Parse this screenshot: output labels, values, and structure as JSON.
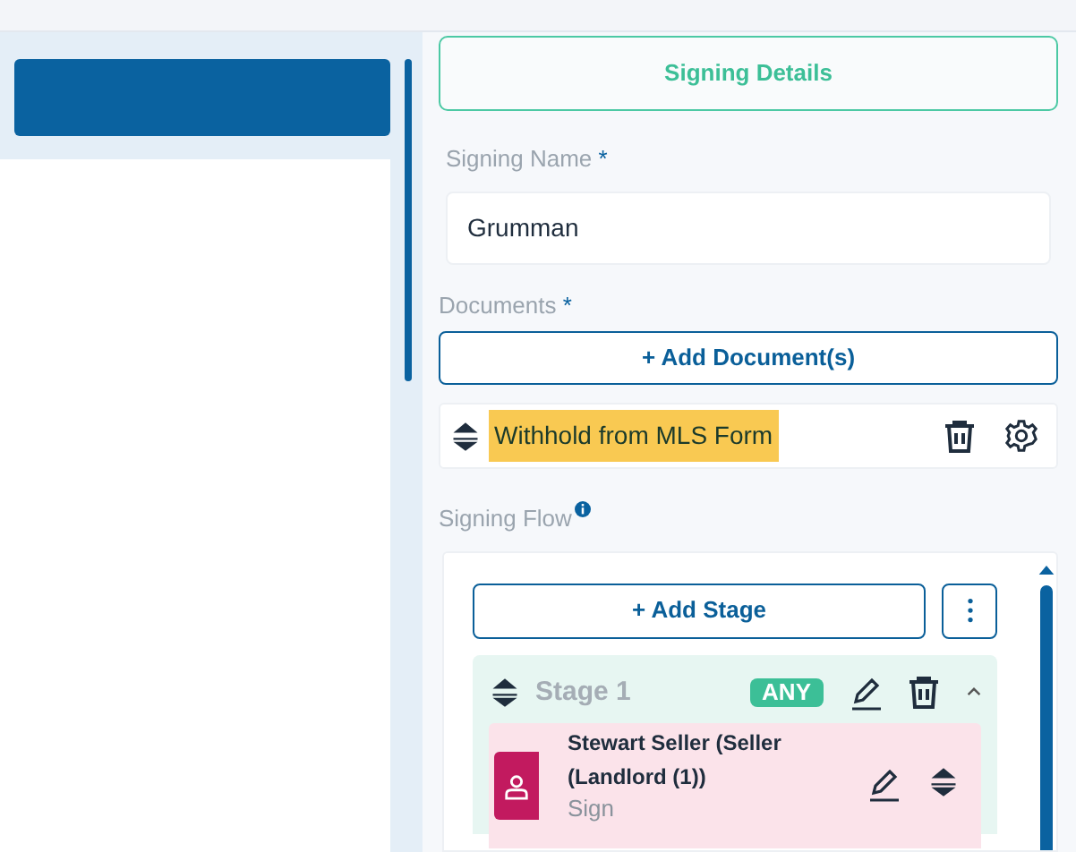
{
  "sidebar": {
    "items": [
      {
        "selected": true
      },
      {
        "selected": false
      }
    ]
  },
  "tabs": [
    {
      "label": "Signing Details",
      "selected": true
    }
  ],
  "signing_name": {
    "label": "Signing Name",
    "required_mark": "*",
    "value": "Grumman"
  },
  "documents": {
    "label": "Documents",
    "required_mark": "*",
    "add_button": "+ Add Document(s)",
    "items": [
      {
        "name": "Withhold from MLS Form",
        "highlighted": true
      }
    ]
  },
  "signing_flow": {
    "label": "Signing Flow",
    "add_stage_button": "+ Add Stage",
    "stages": [
      {
        "title": "Stage 1",
        "badge": "ANY",
        "expanded": true,
        "signers": [
          {
            "name": "Stewart Seller (Seller (Landlord (1))",
            "role": "Sign"
          }
        ]
      }
    ]
  }
}
